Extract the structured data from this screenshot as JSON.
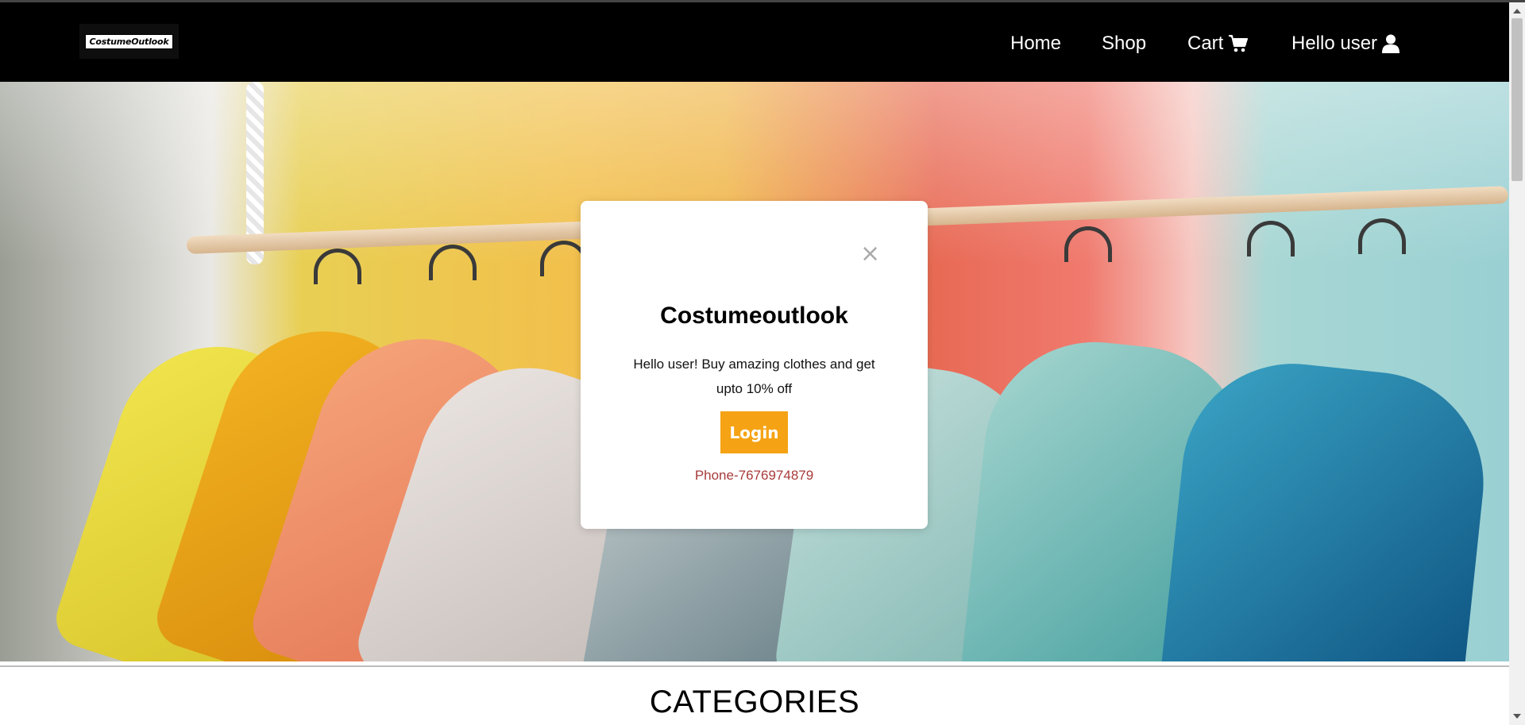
{
  "navbar": {
    "logo_text": "CostumeOutlook",
    "links": [
      {
        "label": "Home"
      },
      {
        "label": "Shop"
      },
      {
        "label": "Cart",
        "icon": "cart-icon"
      },
      {
        "label": "Hello user",
        "icon": "user-icon"
      }
    ]
  },
  "modal": {
    "title": "Costumeoutlook",
    "message": "Hello user! Buy amazing clothes and get upto 10% off",
    "login_label": "Login",
    "phone": "Phone-7676974879",
    "close_symbol": "×"
  },
  "categories": {
    "title": "CATEGORIES"
  },
  "colors": {
    "navbar_bg": "#000000",
    "login_button": "#f5a314",
    "phone_text": "#a83b3b"
  }
}
